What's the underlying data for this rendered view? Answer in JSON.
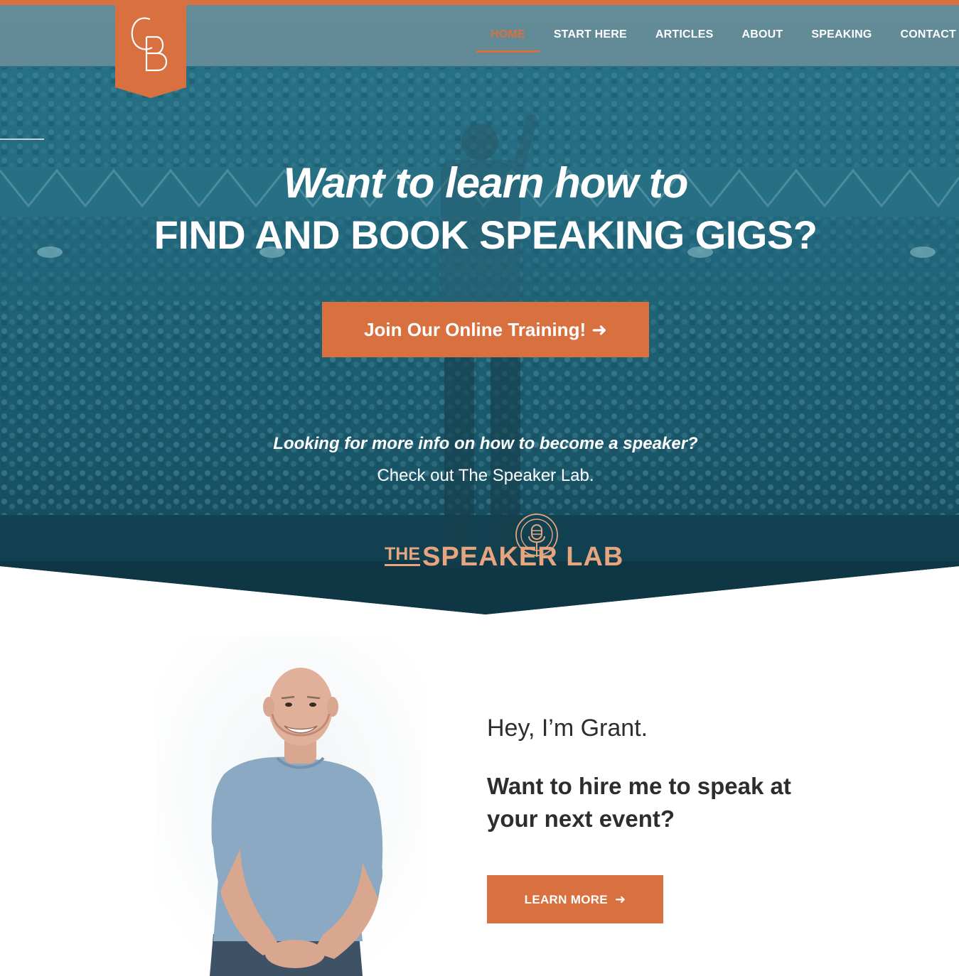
{
  "colors": {
    "accent": "#d8703f",
    "hero_teal": "#1f6477",
    "text_dark": "#2d2d2d",
    "logo_light": "#e6a57e"
  },
  "logo": {
    "icon": "cb-monogram-icon"
  },
  "nav": {
    "items": [
      {
        "label": "HOME",
        "active": true
      },
      {
        "label": "START HERE",
        "active": false
      },
      {
        "label": "ARTICLES",
        "active": false
      },
      {
        "label": "ABOUT",
        "active": false
      },
      {
        "label": "SPEAKING",
        "active": false
      },
      {
        "label": "CONTACT",
        "active": false
      }
    ]
  },
  "hero": {
    "title_line1": "Want to learn how to",
    "title_line2": "FIND AND BOOK SPEAKING GIGS?",
    "cta_label": "Join Our Online Training!",
    "cta_icon": "arrow-right-icon",
    "sub_question": "Looking for more info on how to become a speaker?",
    "sub_link": "Check out The Speaker Lab.",
    "speaker_lab": {
      "the": "THE",
      "name": "SPEAKER LAB",
      "icon": "microphone-icon"
    }
  },
  "about": {
    "greeting": "Hey, I’m Grant.",
    "hire_question": "Want to hire me to speak at your next event?",
    "button_label": "LEARN MORE",
    "button_icon": "arrow-right-icon"
  }
}
